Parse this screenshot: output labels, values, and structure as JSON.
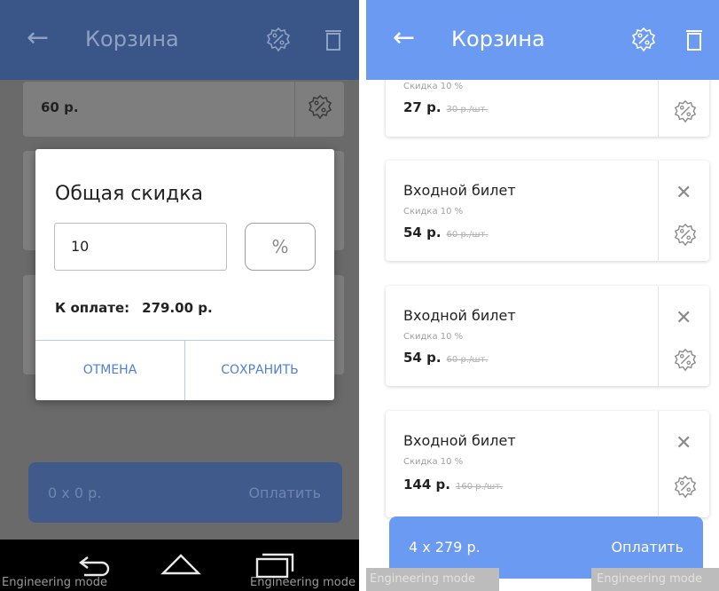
{
  "app": {
    "title": "Корзина",
    "back_icon": "arrow-left-icon",
    "discount_icon": "percent-badge-icon",
    "delete_icon": "trash-icon",
    "accent_color": "#6a9af2"
  },
  "left_screen": {
    "background_card_price": "60 р.",
    "dialog": {
      "title": "Общая скидка",
      "input_value": "10",
      "unit_label": "%",
      "total_label": "К оплате:",
      "total_value": "279.00 р.",
      "cancel_label": "ОТМЕНА",
      "save_label": "СОХРАНИТЬ"
    },
    "pay_bar": {
      "count_text": "0 x 0 р.",
      "pay_label": "Оплатить"
    },
    "navbar": {
      "engineering_left": "Engineering mode",
      "engineering_right": "Engineering mode"
    }
  },
  "right_screen": {
    "items": [
      {
        "name": "",
        "discount": "Скидка 10 %",
        "price": "27 р.",
        "old_price": "30 р./шт."
      },
      {
        "name": "Входной билет",
        "discount": "Скидка 10 %",
        "price": "54 р.",
        "old_price": "60 р./шт."
      },
      {
        "name": "Входной билет",
        "discount": "Скидка 10 %",
        "price": "54 р.",
        "old_price": "60 р./шт."
      },
      {
        "name": "Входной билет",
        "discount": "Скидка 10 %",
        "price": "144 р.",
        "old_price": "160 р./шт."
      }
    ],
    "pay_bar": {
      "count_text": "4 x 279 р.",
      "pay_label": "Оплатить"
    },
    "engineering_left": "Engineering mode",
    "engineering_right": "Engineering mode"
  }
}
